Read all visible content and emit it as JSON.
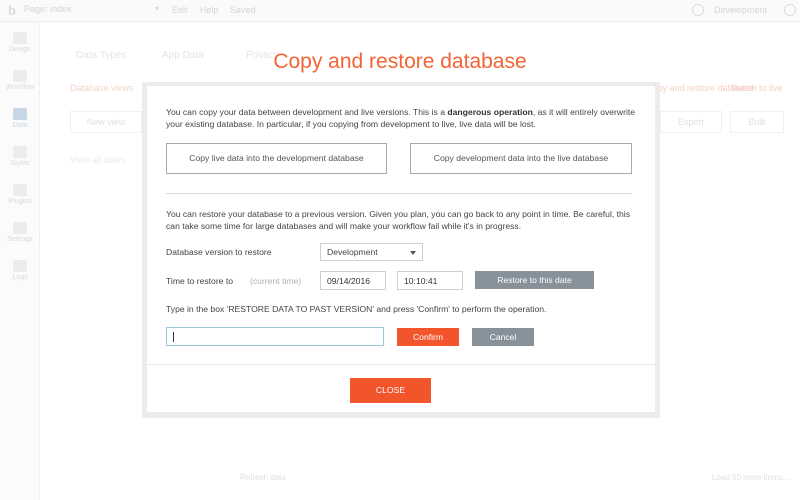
{
  "topbar": {
    "page_label": "Page: index",
    "menu": [
      "Edit",
      "Help",
      "Saved"
    ],
    "environment": "Development"
  },
  "sidebar": {
    "items": [
      {
        "label": "Design",
        "icon": "design-icon"
      },
      {
        "label": "Workflow",
        "icon": "workflow-icon"
      },
      {
        "label": "Data",
        "icon": "data-icon"
      },
      {
        "label": "Styles",
        "icon": "styles-icon"
      },
      {
        "label": "Plugins",
        "icon": "plugins-icon"
      },
      {
        "label": "Settings",
        "icon": "settings-icon"
      },
      {
        "label": "Logs",
        "icon": "logs-icon"
      }
    ]
  },
  "background": {
    "tabs": [
      "Data Types",
      "App Data",
      "Privacy"
    ],
    "links": {
      "left": "Database views",
      "right1": "Copy and restore database",
      "right2": "Switch to live"
    },
    "buttons": {
      "new_view": "New view",
      "export": "Export",
      "bulk": "Bulk"
    },
    "view_all": "View all users",
    "footer_left": "Refresh data",
    "footer_right": "Load 50 more items..."
  },
  "modal": {
    "title": "Copy and restore database",
    "copy_text_before": "You can copy your data between development and live versions. This is a ",
    "copy_text_bold": "dangerous operation",
    "copy_text_after": ", as it will entirely overwrite your existing database. In particular, if you copying from development to live, live data will be lost.",
    "copy_live_to_dev": "Copy live data into the development database",
    "copy_dev_to_live": "Copy development data into the live database",
    "restore_text": "You can restore your database to a previous version. Given you plan, you can go back to any point in time. Be careful, this can take some time for large databases and will make your workflow fail while it's in progress.",
    "db_version_label": "Database version to restore",
    "db_version_value": "Development",
    "time_label": "Time to restore to",
    "current_time": "(current time)",
    "date_value": "09/14/2016",
    "time_value": "10:10:41",
    "restore_button": "Restore to this date",
    "confirm_instruction": "Type in the box 'RESTORE DATA TO PAST VERSION' and press 'Confirm' to perform the operation.",
    "confirm_input_value": "",
    "confirm_button": "Confirm",
    "cancel_button": "Cancel",
    "close_button": "CLOSE"
  },
  "colors": {
    "accent": "#f26434",
    "button_orange": "#f2542c",
    "button_grey": "#879199"
  }
}
